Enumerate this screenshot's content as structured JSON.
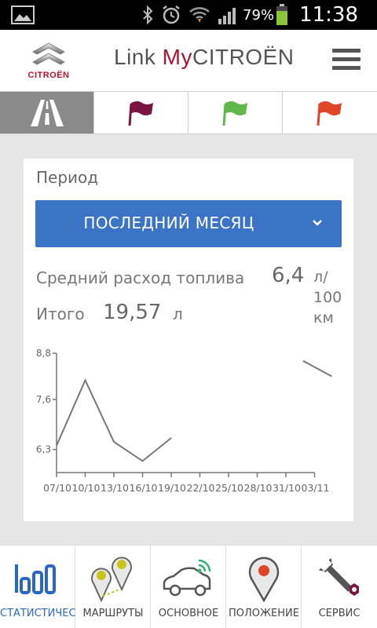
{
  "status_bar": {
    "battery_percent": "79%",
    "time": "11:38"
  },
  "header": {
    "logo_text": "CITROËN",
    "brand_prefix": "Link ",
    "brand_my": "My",
    "brand_suffix": "CITROËN"
  },
  "filter_tabs": [
    {
      "name": "road",
      "color": "#ffffff",
      "active": true
    },
    {
      "name": "flag-purple",
      "color": "#7a1440"
    },
    {
      "name": "flag-green",
      "color": "#5fb84a"
    },
    {
      "name": "flag-red",
      "color": "#e0452a"
    }
  ],
  "card": {
    "period_label": "Период",
    "period_value": "ПОСЛЕДНИЙ МЕСЯЦ",
    "avg_label": "Средний расход топлива",
    "avg_value": "6,4",
    "avg_unit": "л/ 100 км",
    "total_label": "Итого",
    "total_value": "19,57",
    "total_unit": "л"
  },
  "chart_data": {
    "type": "line",
    "categories": [
      "07/10",
      "10/10",
      "13/10",
      "16/10",
      "19/10",
      "22/10",
      "25/10",
      "28/10",
      "31/10",
      "03/11"
    ],
    "y_tick_labels": [
      "8,8",
      "7,6",
      "6,3"
    ],
    "y_ticks": [
      8.8,
      7.6,
      6.3
    ],
    "ylim": [
      5.7,
      8.8
    ],
    "segments": [
      [
        {
          "x": 0,
          "y": 6.4
        },
        {
          "x": 1,
          "y": 8.1
        },
        {
          "x": 2,
          "y": 6.5
        },
        {
          "x": 3,
          "y": 6.0
        },
        {
          "x": 4,
          "y": 6.6
        }
      ],
      [
        {
          "x": 8.6,
          "y": 8.6
        },
        {
          "x": 9.6,
          "y": 8.2
        }
      ]
    ],
    "grid": false
  },
  "bottom_nav": [
    {
      "label": "СТАТИСТИЧЕС",
      "active": true
    },
    {
      "label": "МАРШРУТЫ"
    },
    {
      "label": "ОСНОВНОЕ"
    },
    {
      "label": "ПОЛОЖЕНИЕ"
    },
    {
      "label": "СЕРВИС"
    }
  ],
  "colors": {
    "accent_blue": "#3b73c7",
    "brand_red": "#a8152e",
    "nav_active": "#2a66c4"
  }
}
